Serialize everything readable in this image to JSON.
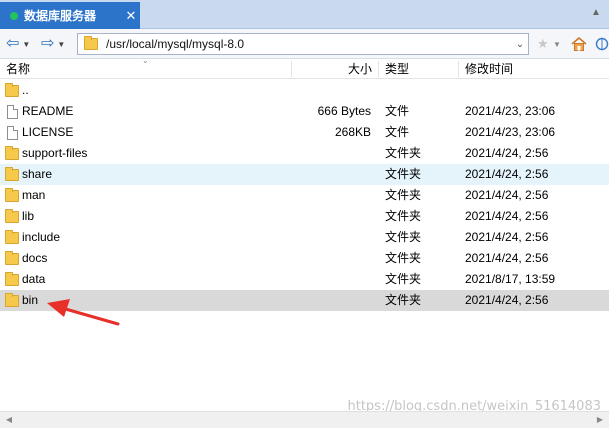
{
  "tab": {
    "title": "数据库服务器",
    "close": "✕"
  },
  "address": {
    "path": "/usr/local/mysql/mysql-8.0"
  },
  "columns": {
    "name": "名称",
    "size": "大小",
    "type": "类型",
    "modified": "修改时间"
  },
  "files": [
    {
      "name": "..",
      "icon": "folder-icon",
      "size": "",
      "type": "",
      "modified": ""
    },
    {
      "name": "README",
      "icon": "file-icon",
      "size": "666 Bytes",
      "type": "文件",
      "modified": "2021/4/23, 23:06"
    },
    {
      "name": "LICENSE",
      "icon": "file-icon",
      "size": "268KB",
      "type": "文件",
      "modified": "2021/4/23, 23:06"
    },
    {
      "name": "support-files",
      "icon": "folder-icon",
      "size": "",
      "type": "文件夹",
      "modified": "2021/4/24, 2:56"
    },
    {
      "name": "share",
      "icon": "folder-icon",
      "size": "",
      "type": "文件夹",
      "modified": "2021/4/24, 2:56"
    },
    {
      "name": "man",
      "icon": "folder-icon",
      "size": "",
      "type": "文件夹",
      "modified": "2021/4/24, 2:56"
    },
    {
      "name": "lib",
      "icon": "folder-icon",
      "size": "",
      "type": "文件夹",
      "modified": "2021/4/24, 2:56"
    },
    {
      "name": "include",
      "icon": "folder-icon",
      "size": "",
      "type": "文件夹",
      "modified": "2021/4/24, 2:56"
    },
    {
      "name": "docs",
      "icon": "folder-icon",
      "size": "",
      "type": "文件夹",
      "modified": "2021/4/24, 2:56"
    },
    {
      "name": "data",
      "icon": "folder-icon",
      "size": "",
      "type": "文件夹",
      "modified": "2021/8/17, 13:59"
    },
    {
      "name": "bin",
      "icon": "folder-icon",
      "size": "",
      "type": "文件夹",
      "modified": "2021/4/24, 2:56"
    }
  ],
  "watermark": "https://blog.csdn.net/weixin_51614083",
  "colors": {
    "tab": "#2b74c9",
    "status_dot": "#21c35a",
    "hover_row": "#e5f3fb",
    "selected_row": "#d9d9d9",
    "arrow": "#e8302a"
  }
}
